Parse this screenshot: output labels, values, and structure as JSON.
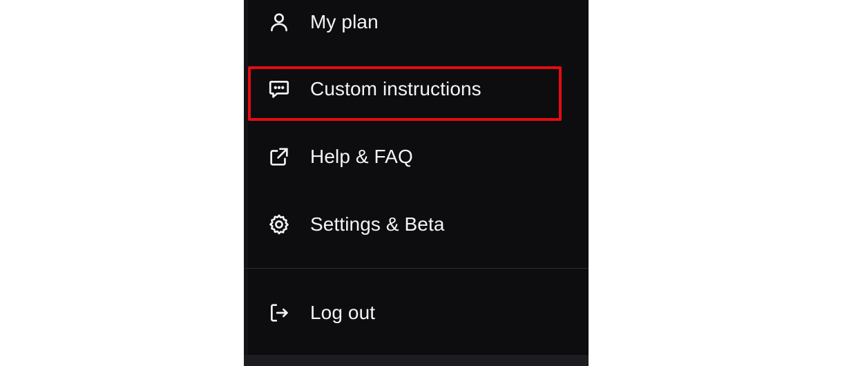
{
  "menu": {
    "items": [
      {
        "label": "My plan",
        "icon": "user-icon"
      },
      {
        "label": "Custom instructions",
        "icon": "chat-bubble-dots-icon",
        "highlighted": true
      },
      {
        "label": "Help & FAQ",
        "icon": "external-link-icon"
      },
      {
        "label": "Settings & Beta",
        "icon": "gear-icon"
      },
      {
        "label": "Log out",
        "icon": "logout-icon"
      }
    ]
  },
  "colors": {
    "panel_background": "#0d0d0f",
    "text": "#f4f4f4",
    "highlight_border": "#e60b12",
    "divider": "#2e2e33"
  }
}
